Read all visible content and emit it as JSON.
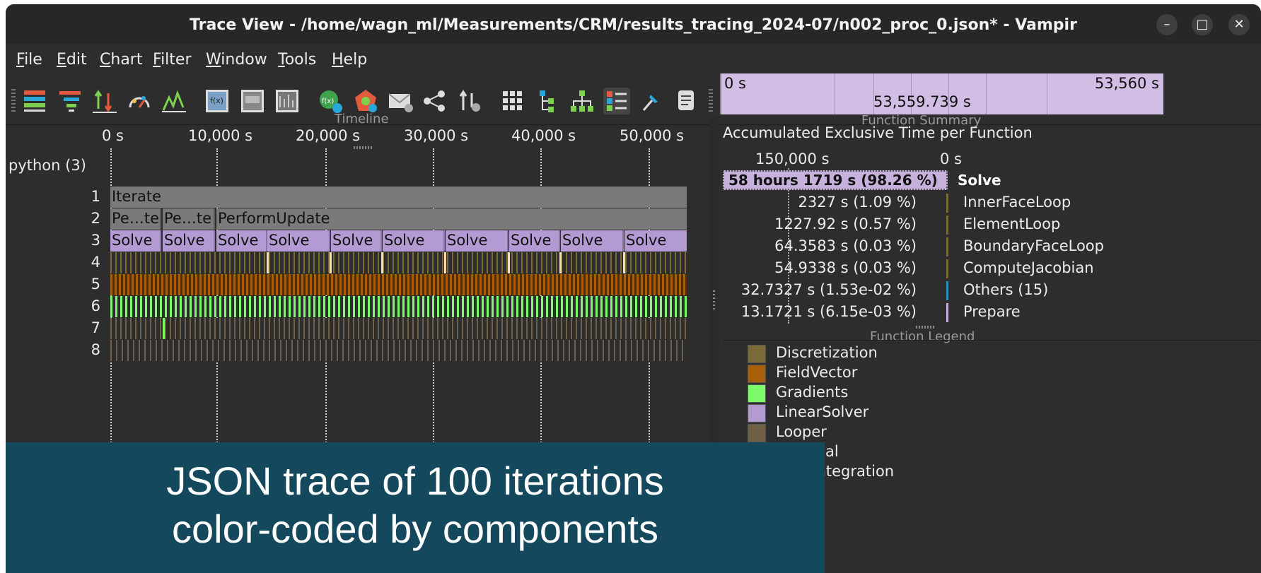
{
  "window": {
    "title": "Trace View - /home/wagn_ml/Measurements/CRM/results_tracing_2024-07/n002_proc_0.json* - Vampir",
    "minimize": "–",
    "maximize": "□",
    "close": "✕"
  },
  "menu": [
    {
      "label": "File",
      "key": "F",
      "rest": "ile"
    },
    {
      "label": "Edit",
      "key": "E",
      "rest": "dit"
    },
    {
      "label": "Chart",
      "key": "C",
      "rest": "hart"
    },
    {
      "label": "Filter",
      "key": "F",
      "rest": "ilter"
    },
    {
      "label": "Window",
      "key": "W",
      "rest": "indow"
    },
    {
      "label": "Tools",
      "key": "T",
      "rest": "ools"
    },
    {
      "label": "Help",
      "key": "H",
      "rest": "elp"
    }
  ],
  "toolbar": {
    "icons": [
      "master-timeline-icon",
      "function-summary-icon",
      "process-timeline-icon",
      "counter-data-icon",
      "performance-radar-icon",
      "communication-matrix-icon",
      "io-summary-icon",
      "call-tree-icon",
      "function-legend-icon",
      "message-summary-icon",
      "context-view-icon",
      "marker-view-icon",
      "grid-icon",
      "tree-icon",
      "hierarchy-icon",
      "legend-list-icon",
      "pin-icon",
      "notes-icon"
    ],
    "zoom": {
      "start": "0 s",
      "end": "53,560 s",
      "duration": "53,559.739 s"
    }
  },
  "timeline": {
    "title": "Timeline",
    "ticks": [
      "0 s",
      "10,000 s",
      "20,000 s",
      "30,000 s",
      "40,000 s",
      "50,000 s"
    ],
    "process": "python (3)",
    "rows": [
      "1",
      "2",
      "3",
      "4",
      "5",
      "6",
      "7",
      "8"
    ],
    "row1": "Iterate",
    "row2": [
      "Pe…te",
      "Pe…te",
      "PerformUpdate"
    ],
    "row3": [
      "Solve",
      "Solve",
      "Solve",
      "Solve",
      "Solve",
      "Solve",
      "Solve",
      "Solve",
      "Solve",
      "Solve"
    ]
  },
  "function_summary": {
    "title": "Function Summary",
    "subtitle": "Accumulated Exclusive Time per Function",
    "axis_left": "150,000 s",
    "axis_right": "0 s",
    "items": [
      {
        "value": "58 hours 1719 s (98.26 %)",
        "name": "Solve",
        "color": "#c6b1dd"
      },
      {
        "value": "2327 s (1.09 %)",
        "name": "InnerFaceLoop",
        "color": "#7d6a38"
      },
      {
        "value": "1227.92 s (0.57 %)",
        "name": "ElementLoop",
        "color": "#7d6a38"
      },
      {
        "value": "64.3583 s (0.03 %)",
        "name": "BoundaryFaceLoop",
        "color": "#7d6a38"
      },
      {
        "value": "54.9338 s (0.03 %)",
        "name": "ComputeJacobian",
        "color": "#7d6a38"
      },
      {
        "value": "32.7327 s (1.53e-02 %)",
        "name": "Others (15)",
        "color": "#2a8fb8"
      },
      {
        "value": "13.1721 s (6.15e-03 %)",
        "name": "Prepare",
        "color": "#c6b1dd"
      }
    ]
  },
  "function_legend": {
    "title": "Function Legend",
    "items": [
      {
        "name": "Discretization",
        "color": "#7a6a35"
      },
      {
        "name": "FieldVector",
        "color": "#a85f0a"
      },
      {
        "name": "Gradients",
        "color": "#7dfa6a"
      },
      {
        "name": "LinearSolver",
        "color": "#b39ad3"
      },
      {
        "name": "Looper",
        "color": "#6f5f45"
      },
      {
        "name": "Residual",
        "color": "#f3ddb8"
      },
      {
        "name": "TimeIntegration",
        "color": "#7a7a7a"
      }
    ]
  },
  "caption": {
    "line1": "JSON trace of 100 iterations",
    "line2": "color-coded by components"
  }
}
